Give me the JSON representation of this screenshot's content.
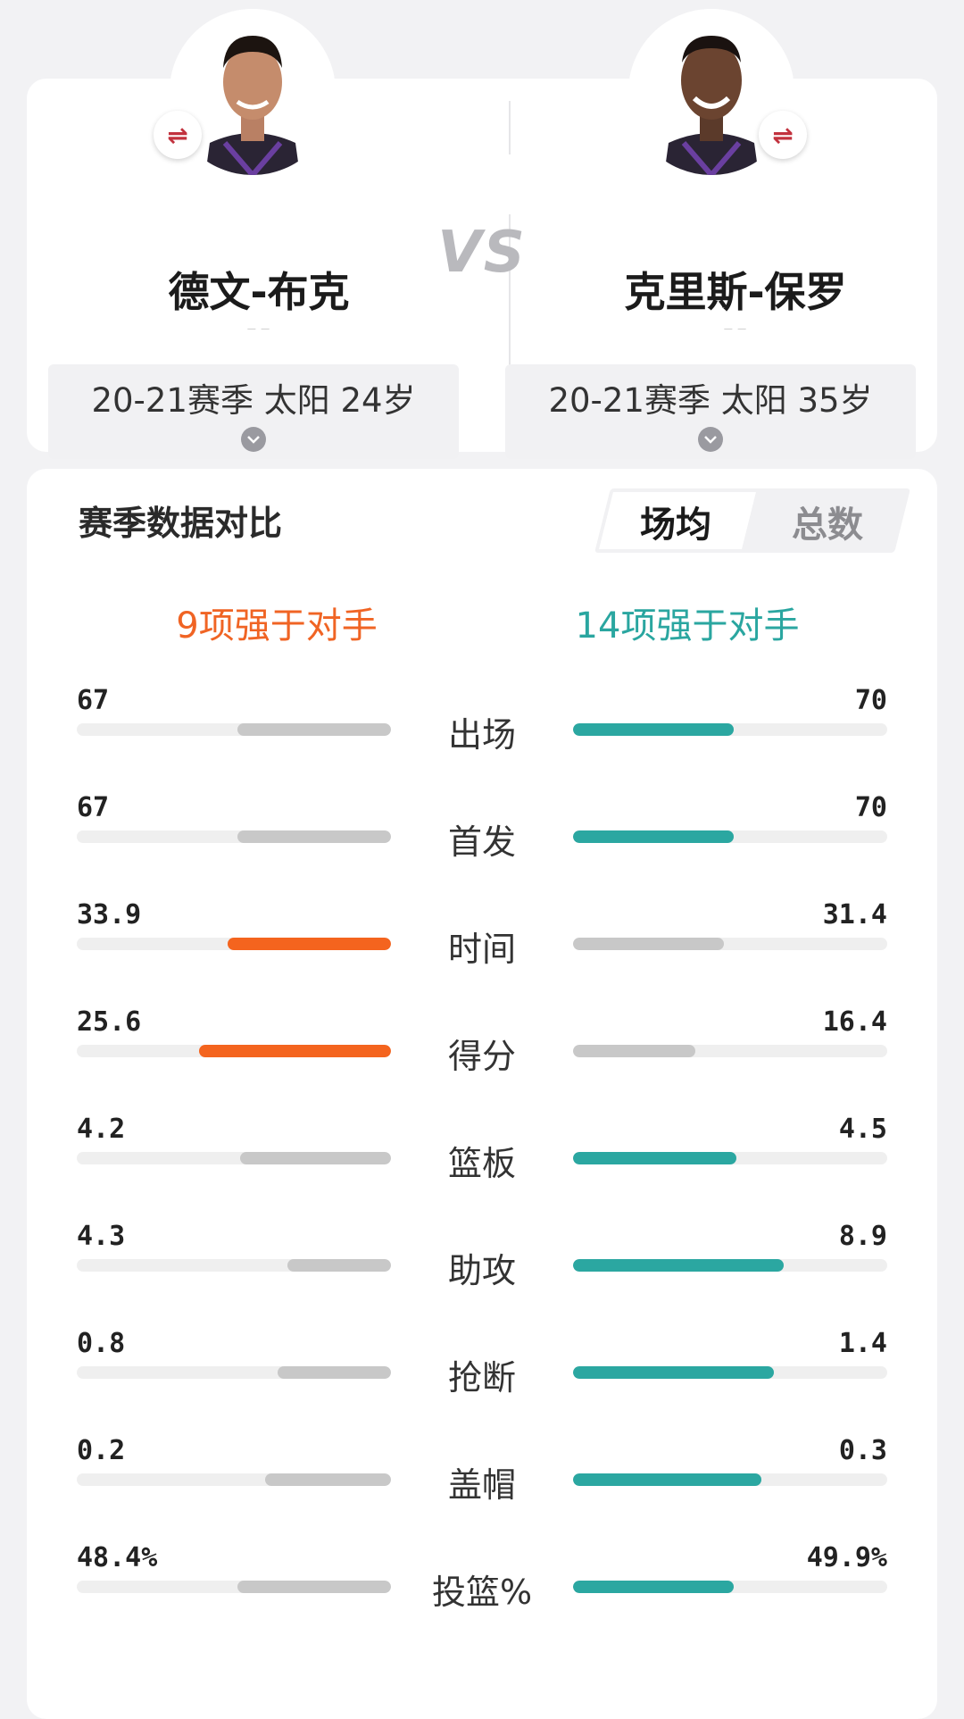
{
  "player_left": {
    "name": "德文-布克",
    "subtitle": "— —",
    "season": "20-21赛季 太阳 24岁"
  },
  "player_right": {
    "name": "克里斯-保罗",
    "subtitle": "— —",
    "season": "20-21赛季 太阳 35岁"
  },
  "vs": "VS",
  "stats_section": {
    "title": "赛季数据对比",
    "tabs": [
      "场均",
      "总数"
    ],
    "active_tab": "场均",
    "summary_left": "9项强于对手",
    "summary_right": "14项强于对手"
  },
  "colors": {
    "left_win": "#f4641e",
    "right_win": "#2ba7a1",
    "neutral": "#c8c8c8"
  },
  "stats": [
    {
      "label": "出场",
      "left": "67",
      "right": "70",
      "left_fraction": 0.49,
      "right_fraction": 0.51,
      "winner": "right"
    },
    {
      "label": "首发",
      "left": "67",
      "right": "70",
      "left_fraction": 0.49,
      "right_fraction": 0.51,
      "winner": "right"
    },
    {
      "label": "时间",
      "left": "33.9",
      "right": "31.4",
      "left_fraction": 0.52,
      "right_fraction": 0.48,
      "winner": "left"
    },
    {
      "label": "得分",
      "left": "25.6",
      "right": "16.4",
      "left_fraction": 0.61,
      "right_fraction": 0.39,
      "winner": "left"
    },
    {
      "label": "篮板",
      "left": "4.2",
      "right": "4.5",
      "left_fraction": 0.48,
      "right_fraction": 0.52,
      "winner": "right"
    },
    {
      "label": "助攻",
      "left": "4.3",
      "right": "8.9",
      "left_fraction": 0.33,
      "right_fraction": 0.67,
      "winner": "right"
    },
    {
      "label": "抢断",
      "left": "0.8",
      "right": "1.4",
      "left_fraction": 0.36,
      "right_fraction": 0.64,
      "winner": "right"
    },
    {
      "label": "盖帽",
      "left": "0.2",
      "right": "0.3",
      "left_fraction": 0.4,
      "right_fraction": 0.6,
      "winner": "right"
    },
    {
      "label": "投篮%",
      "left": "48.4%",
      "right": "49.9%",
      "left_fraction": 0.49,
      "right_fraction": 0.51,
      "winner": "right"
    }
  ]
}
